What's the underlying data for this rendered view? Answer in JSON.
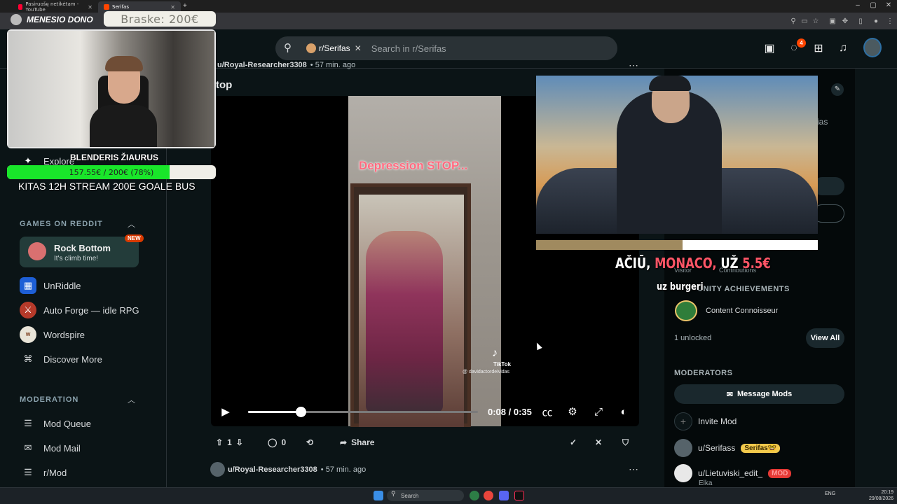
{
  "browser": {
    "tabs": [
      {
        "label": "Pasiruošę netikėtam - YouTube",
        "color": "#ff0033"
      },
      {
        "label": "Serifas",
        "color": "#ff4500"
      }
    ],
    "new_tab": "+"
  },
  "header": {
    "search_chip": "r/Serifas",
    "search_placeholder": "Search in r/Serifas",
    "inbox_badge": "4"
  },
  "sidebar": {
    "explore": "Explore",
    "games_title": "GAMES ON REDDIT",
    "featured_game": {
      "title": "Rock Bottom",
      "subtitle": "It's climb time!",
      "badge": "NEW"
    },
    "games": [
      {
        "label": "UnRiddle",
        "color": "#1e5fd6"
      },
      {
        "label": "Auto Forge — idle RPG",
        "color": "#b63a2a"
      },
      {
        "label": "Wordspire",
        "color": "#e9e4d8"
      },
      {
        "label": "Discover More",
        "color": "#0b1416"
      }
    ],
    "moderation_title": "MODERATION",
    "moderation": [
      {
        "label": "Mod Queue"
      },
      {
        "label": "Mod Mail"
      },
      {
        "label": "r/Mod"
      }
    ]
  },
  "post": {
    "author": "u/Royal-Researcher3308",
    "time": "• 57 min. ago",
    "title_fragment": "top",
    "video_caption": "Depression STOP...",
    "tiktok_label": "TikTok",
    "tiktok_handle": "@ davidactordeividas",
    "time_display": "0:08 / 0:35",
    "progress": 0.23,
    "votes": "1",
    "comments": "0",
    "share": "Share"
  },
  "post2": {
    "author": "u/Royal-Researcher3308",
    "time": "• 57 min. ago"
  },
  "right_panel": {
    "partial_text": "ias",
    "visitors_label": "Visitor",
    "contributions_label": "Contributions",
    "achievements_title": "UNITY ACHIEVEMENTS",
    "achievement": "Content Connoisseur",
    "unlocked": "1 unlocked",
    "view_all": "View All",
    "moderators_title": "MODERATORS",
    "message_mods": "Message Mods",
    "invite_mod": "Invite Mod",
    "mods": [
      {
        "name": "u/Serifass",
        "flair": "Serifas🤓",
        "flair_color": "#f2c94c"
      },
      {
        "name": "u/Lietuviski_edit_",
        "flair": "MOD",
        "flair_color": "#e53935",
        "sub": "Elka"
      }
    ]
  },
  "overlay_video": {
    "thanks_prefix": "AČIŪ,",
    "thanks_name": "MONACO,",
    "thanks_mid": "UŽ",
    "thanks_amount": "5.5€",
    "thanks_suffix": "uz burgeri",
    "progress": 0.52
  },
  "stream": {
    "dono_label": "MENESIO DONO",
    "braske": "Braske: 200€",
    "donor_name": "BLENDERIS ŽIAURUS",
    "goal_text": "157.55€ / 200€ (78%)",
    "goal_fraction": 0.78,
    "banner": "KITAS 12H STREAM 200E GOALE BUS"
  },
  "taskbar": {
    "search": "Search",
    "lang": "ENG",
    "time": "20:19",
    "date": "29/08/2026"
  }
}
